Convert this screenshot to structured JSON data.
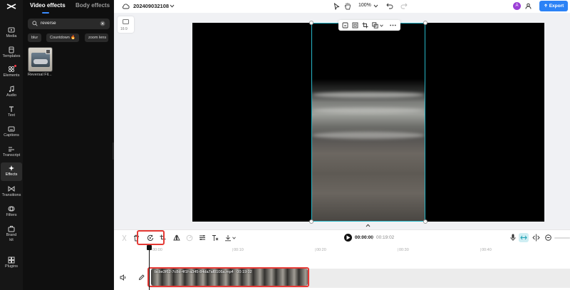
{
  "rail": {
    "items": [
      {
        "label": "Media",
        "icon": "media-icon"
      },
      {
        "label": "Templates",
        "icon": "templates-icon"
      },
      {
        "label": "Elements",
        "icon": "elements-icon"
      },
      {
        "label": "Audio",
        "icon": "audio-icon"
      },
      {
        "label": "Text",
        "icon": "text-icon"
      },
      {
        "label": "Captions",
        "icon": "captions-icon"
      },
      {
        "label": "Transcript",
        "icon": "transcript-icon"
      },
      {
        "label": "Effects",
        "icon": "effects-icon",
        "active": true
      },
      {
        "label": "Transitions",
        "icon": "transitions-icon"
      },
      {
        "label": "Filters",
        "icon": "filters-icon"
      },
      {
        "label": "Brand kit",
        "icon": "brand-kit-icon"
      },
      {
        "label": "Plugins",
        "icon": "plugins-icon"
      }
    ]
  },
  "panel": {
    "tabs": [
      "Video effects",
      "Body effects"
    ],
    "search": {
      "value": "reverse"
    },
    "chips": [
      "blur",
      "Countdown",
      "zoom lens"
    ],
    "chip_fire_icon": "🔥",
    "results": [
      {
        "label": "Reversal Fil..."
      }
    ]
  },
  "topbar": {
    "project_name": "202409032108",
    "zoom": "100%",
    "avatar_initial": "A",
    "export_label": "Export"
  },
  "canvas": {
    "ratio_label": "16:9",
    "accent": "#27b7c9"
  },
  "timeline": {
    "time_current": "00:00:00",
    "time_separator": "|",
    "time_total": "00:19:02",
    "ruler": [
      "00:00",
      "00:10",
      "00:20",
      "00:30",
      "00:40"
    ],
    "clip": {
      "name": "bcbe3f62-7c8d-4f1f-a345-84da7af8106a.mp4",
      "duration": "00:19:02"
    },
    "highlight_color": "#e53935"
  },
  "colors": {
    "export": "#2b82f6",
    "avatar": "#9b3fd6"
  }
}
